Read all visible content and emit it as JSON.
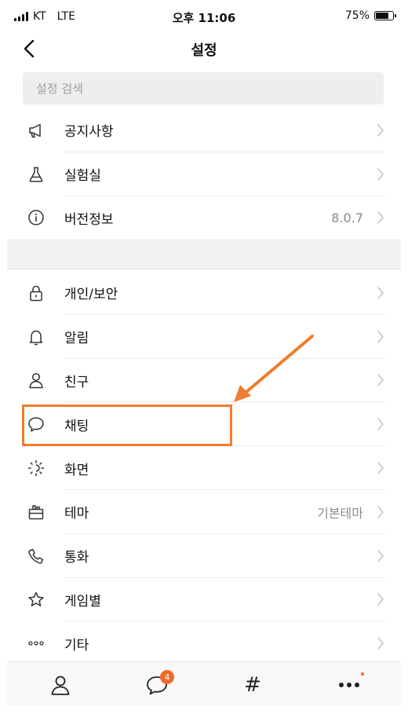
{
  "status_bar": {
    "carrier": "KT",
    "network": "LTE",
    "time": "오후 11:06",
    "battery": "75%",
    "battery_level": 0.75
  },
  "nav": {
    "title": "설정",
    "back_icon": "chevron-left-icon"
  },
  "search": {
    "placeholder": "설정 검색",
    "value": ""
  },
  "section1": [
    {
      "name": "notice",
      "label": "공지사항",
      "icon": "megaphone-icon",
      "value": ""
    },
    {
      "name": "lab",
      "label": "실험실",
      "icon": "flask-icon",
      "value": ""
    },
    {
      "name": "version",
      "label": "버전정보",
      "icon": "info-icon",
      "value": "8.0.7"
    }
  ],
  "section2": [
    {
      "name": "privacy",
      "label": "개인/보안",
      "icon": "lock-icon",
      "value": ""
    },
    {
      "name": "notifications",
      "label": "알림",
      "icon": "bell-icon",
      "value": ""
    },
    {
      "name": "friends",
      "label": "친구",
      "icon": "person-icon",
      "value": ""
    },
    {
      "name": "chat",
      "label": "채팅",
      "icon": "chat-bubble-icon",
      "value": ""
    },
    {
      "name": "display",
      "label": "화면",
      "icon": "brightness-icon",
      "value": ""
    },
    {
      "name": "theme",
      "label": "테마",
      "icon": "theme-icon",
      "value": "기본테마"
    },
    {
      "name": "call",
      "label": "통화",
      "icon": "phone-icon",
      "value": ""
    },
    {
      "name": "games",
      "label": "게임별",
      "icon": "star-icon",
      "value": ""
    },
    {
      "name": "etc",
      "label": "기타",
      "icon": "more-dots-icon",
      "value": ""
    }
  ],
  "tab_bar": {
    "tabs": [
      {
        "name": "friends",
        "icon": "person-icon"
      },
      {
        "name": "chats",
        "icon": "chat-bubble-icon",
        "badge": "4"
      },
      {
        "name": "hashtag",
        "icon": "hashtag-icon",
        "glyph": "#"
      },
      {
        "name": "more",
        "icon": "more-dots-icon",
        "has_dot": true
      }
    ]
  },
  "colors": {
    "accent": "#ee7d2e",
    "badge": "#ef6a2c",
    "divider": "#ececec",
    "section_gap": "#f2f2f2",
    "search_bg": "#eeeeee"
  }
}
